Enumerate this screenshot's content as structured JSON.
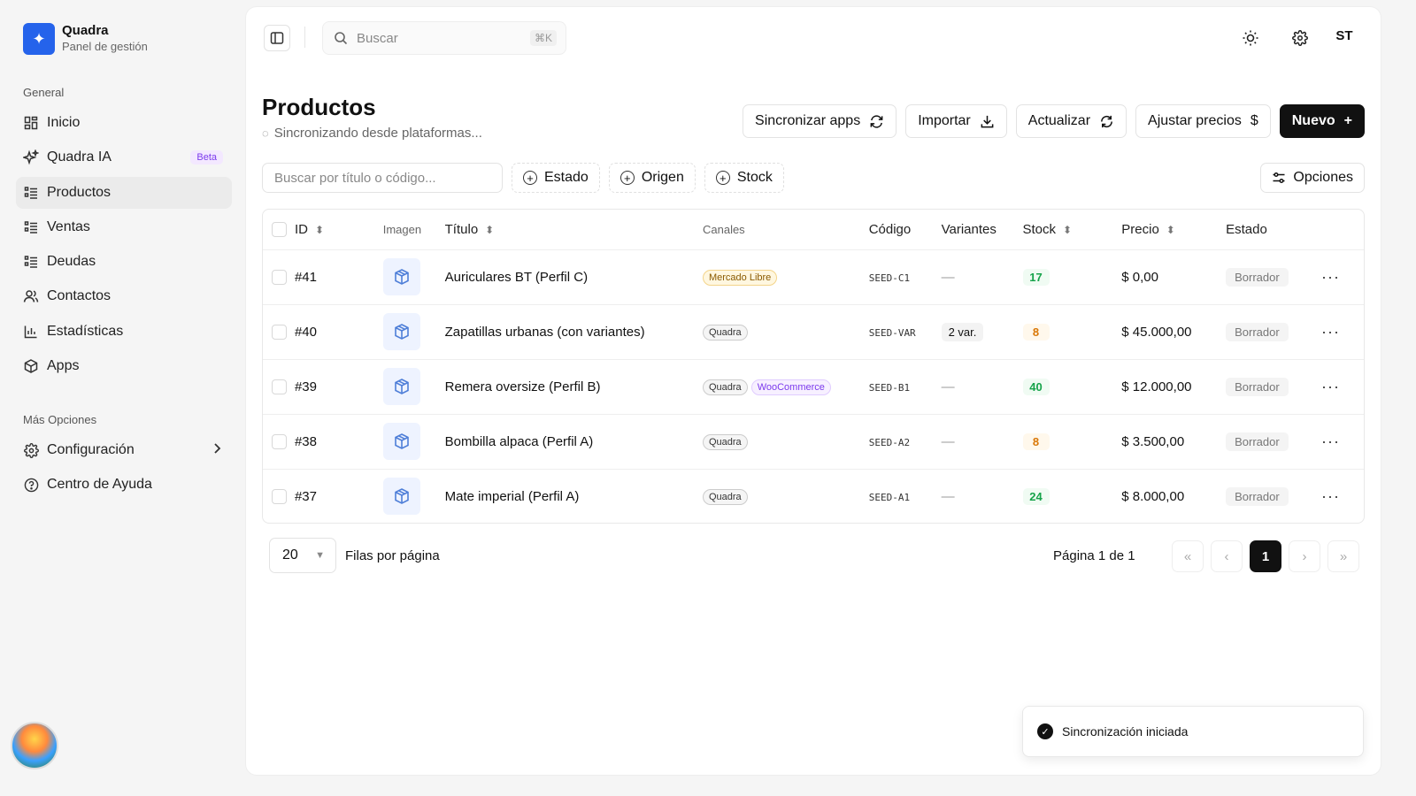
{
  "brand": {
    "name": "Quadra",
    "subtitle": "Panel de gestión",
    "logo_icon": "sparkle-icon",
    "accent": "#2563eb"
  },
  "sidebar": {
    "general_label": "General",
    "items": [
      {
        "label": "Inicio",
        "icon": "dashboard-icon"
      },
      {
        "label": "Quadra IA",
        "icon": "sparkles-icon",
        "badge": "Beta"
      },
      {
        "label": "Productos",
        "icon": "list-icon",
        "active": true
      },
      {
        "label": "Ventas",
        "icon": "list-icon"
      },
      {
        "label": "Deudas",
        "icon": "list-icon"
      },
      {
        "label": "Contactos",
        "icon": "users-icon"
      },
      {
        "label": "Estadísticas",
        "icon": "chart-icon"
      },
      {
        "label": "Apps",
        "icon": "box-icon"
      }
    ],
    "more_label": "Más Opciones",
    "more_items": [
      {
        "label": "Configuración",
        "icon": "gear-icon"
      },
      {
        "label": "Centro de Ayuda",
        "icon": "help-icon"
      }
    ]
  },
  "topbar": {
    "search_placeholder": "Buscar",
    "search_shortcut": "⌘K",
    "user_initials": "ST"
  },
  "page": {
    "title": "Productos",
    "subtitle": "Sincronizando desde plataformas...",
    "actions": {
      "sync": "Sincronizar apps",
      "import": "Importar",
      "refresh": "Actualizar",
      "prices": "Ajustar precios",
      "new": "Nuevo"
    },
    "filters": {
      "search_placeholder": "Buscar por título o código...",
      "estado": "Estado",
      "origen": "Origen",
      "stock": "Stock",
      "options": "Opciones"
    }
  },
  "table": {
    "headers": {
      "id": "ID",
      "image": "Imagen",
      "title": "Título",
      "channels": "Canales",
      "code": "Código",
      "variants": "Variantes",
      "stock": "Stock",
      "price": "Precio",
      "status": "Estado"
    },
    "rows": [
      {
        "id": "#41",
        "title": "Auriculares BT (Perfil C)",
        "channels": [
          "Mercado Libre"
        ],
        "code": "SEED-C1",
        "variants": "—",
        "stock": "17",
        "stock_level": "green",
        "price": "$ 0,00",
        "status": "Borrador"
      },
      {
        "id": "#40",
        "title": "Zapatillas urbanas (con variantes)",
        "channels": [
          "Quadra"
        ],
        "code": "SEED-VAR",
        "variants": "2 var.",
        "stock": "8",
        "stock_level": "amber",
        "price": "$ 45.000,00",
        "status": "Borrador"
      },
      {
        "id": "#39",
        "title": "Remera oversize (Perfil B)",
        "channels": [
          "Quadra",
          "WooCommerce"
        ],
        "code": "SEED-B1",
        "variants": "—",
        "stock": "40",
        "stock_level": "green",
        "price": "$ 12.000,00",
        "status": "Borrador"
      },
      {
        "id": "#38",
        "title": "Bombilla alpaca (Perfil A)",
        "channels": [
          "Quadra"
        ],
        "code": "SEED-A2",
        "variants": "—",
        "stock": "8",
        "stock_level": "amber",
        "price": "$ 3.500,00",
        "status": "Borrador"
      },
      {
        "id": "#37",
        "title": "Mate imperial (Perfil A)",
        "channels": [
          "Quadra"
        ],
        "code": "SEED-A1",
        "variants": "—",
        "stock": "24",
        "stock_level": "green",
        "price": "$ 8.000,00",
        "status": "Borrador"
      }
    ]
  },
  "pagination": {
    "rows_per_page": "20",
    "rows_label": "Filas por página",
    "page_info": "Página 1 de 1",
    "current_page": "1"
  },
  "toast": {
    "message": "Sincronización iniciada"
  }
}
